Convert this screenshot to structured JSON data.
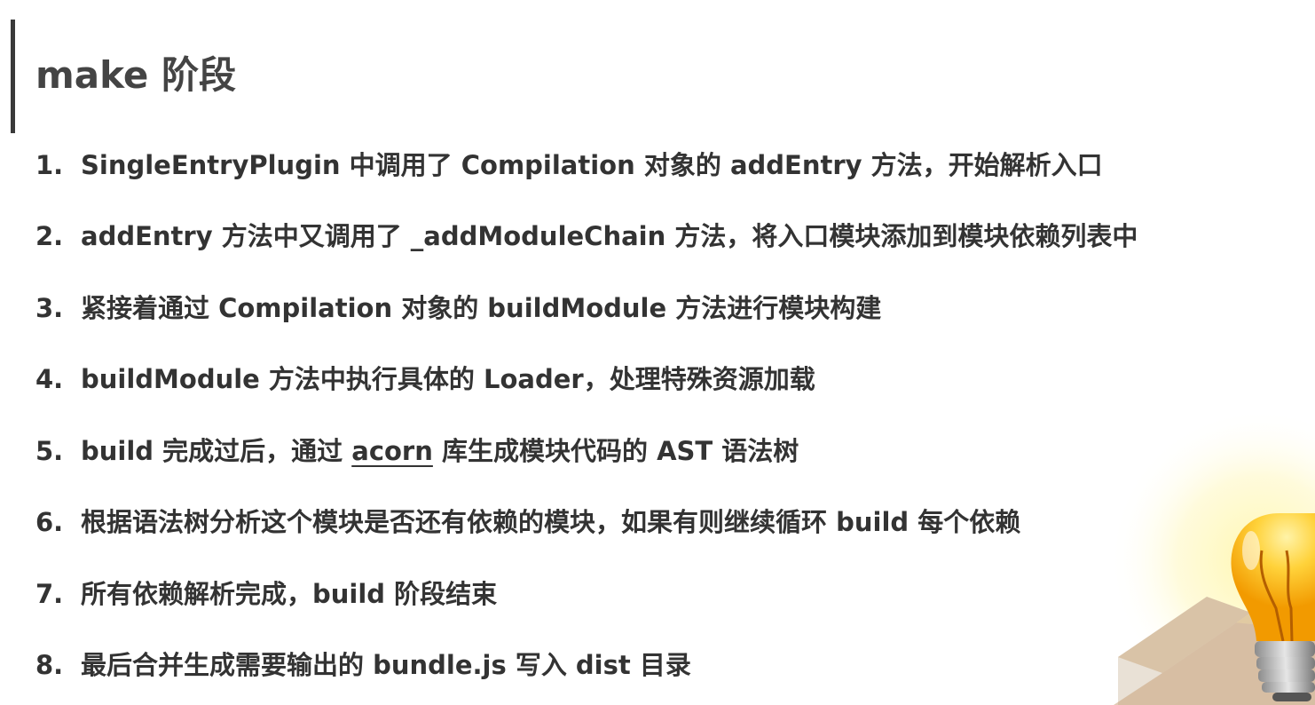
{
  "title": "make 阶段",
  "steps": [
    {
      "num": "1.",
      "text": "SingleEntryPlugin 中调用了 Compilation 对象的 addEntry 方法，开始解析入口"
    },
    {
      "num": "2.",
      "text": "addEntry 方法中又调用了 _addModuleChain 方法，将入口模块添加到模块依赖列表中"
    },
    {
      "num": "3.",
      "text": "紧接着通过 Compilation 对象的 buildModule 方法进行模块构建"
    },
    {
      "num": "4.",
      "text": "buildModule 方法中执行具体的 Loader，处理特殊资源加载"
    },
    {
      "num": "5.",
      "text_before": "build 完成过后，通过 ",
      "link": "acorn",
      "text_after": " 库生成模块代码的 AST 语法树"
    },
    {
      "num": "6.",
      "text": "根据语法树分析这个模块是否还有依赖的模块，如果有则继续循环 build 每个依赖"
    },
    {
      "num": "7.",
      "text": "所有依赖解析完成，build 阶段结束"
    },
    {
      "num": "8.",
      "text": "最后合并生成需要输出的 bundle.js 写入 dist 目录"
    }
  ],
  "decoration": {
    "icon": "lightbulb-icon",
    "glow_color": "#fff3a0",
    "bulb_color": "#f7b318",
    "box_color": "#c9a27a"
  }
}
